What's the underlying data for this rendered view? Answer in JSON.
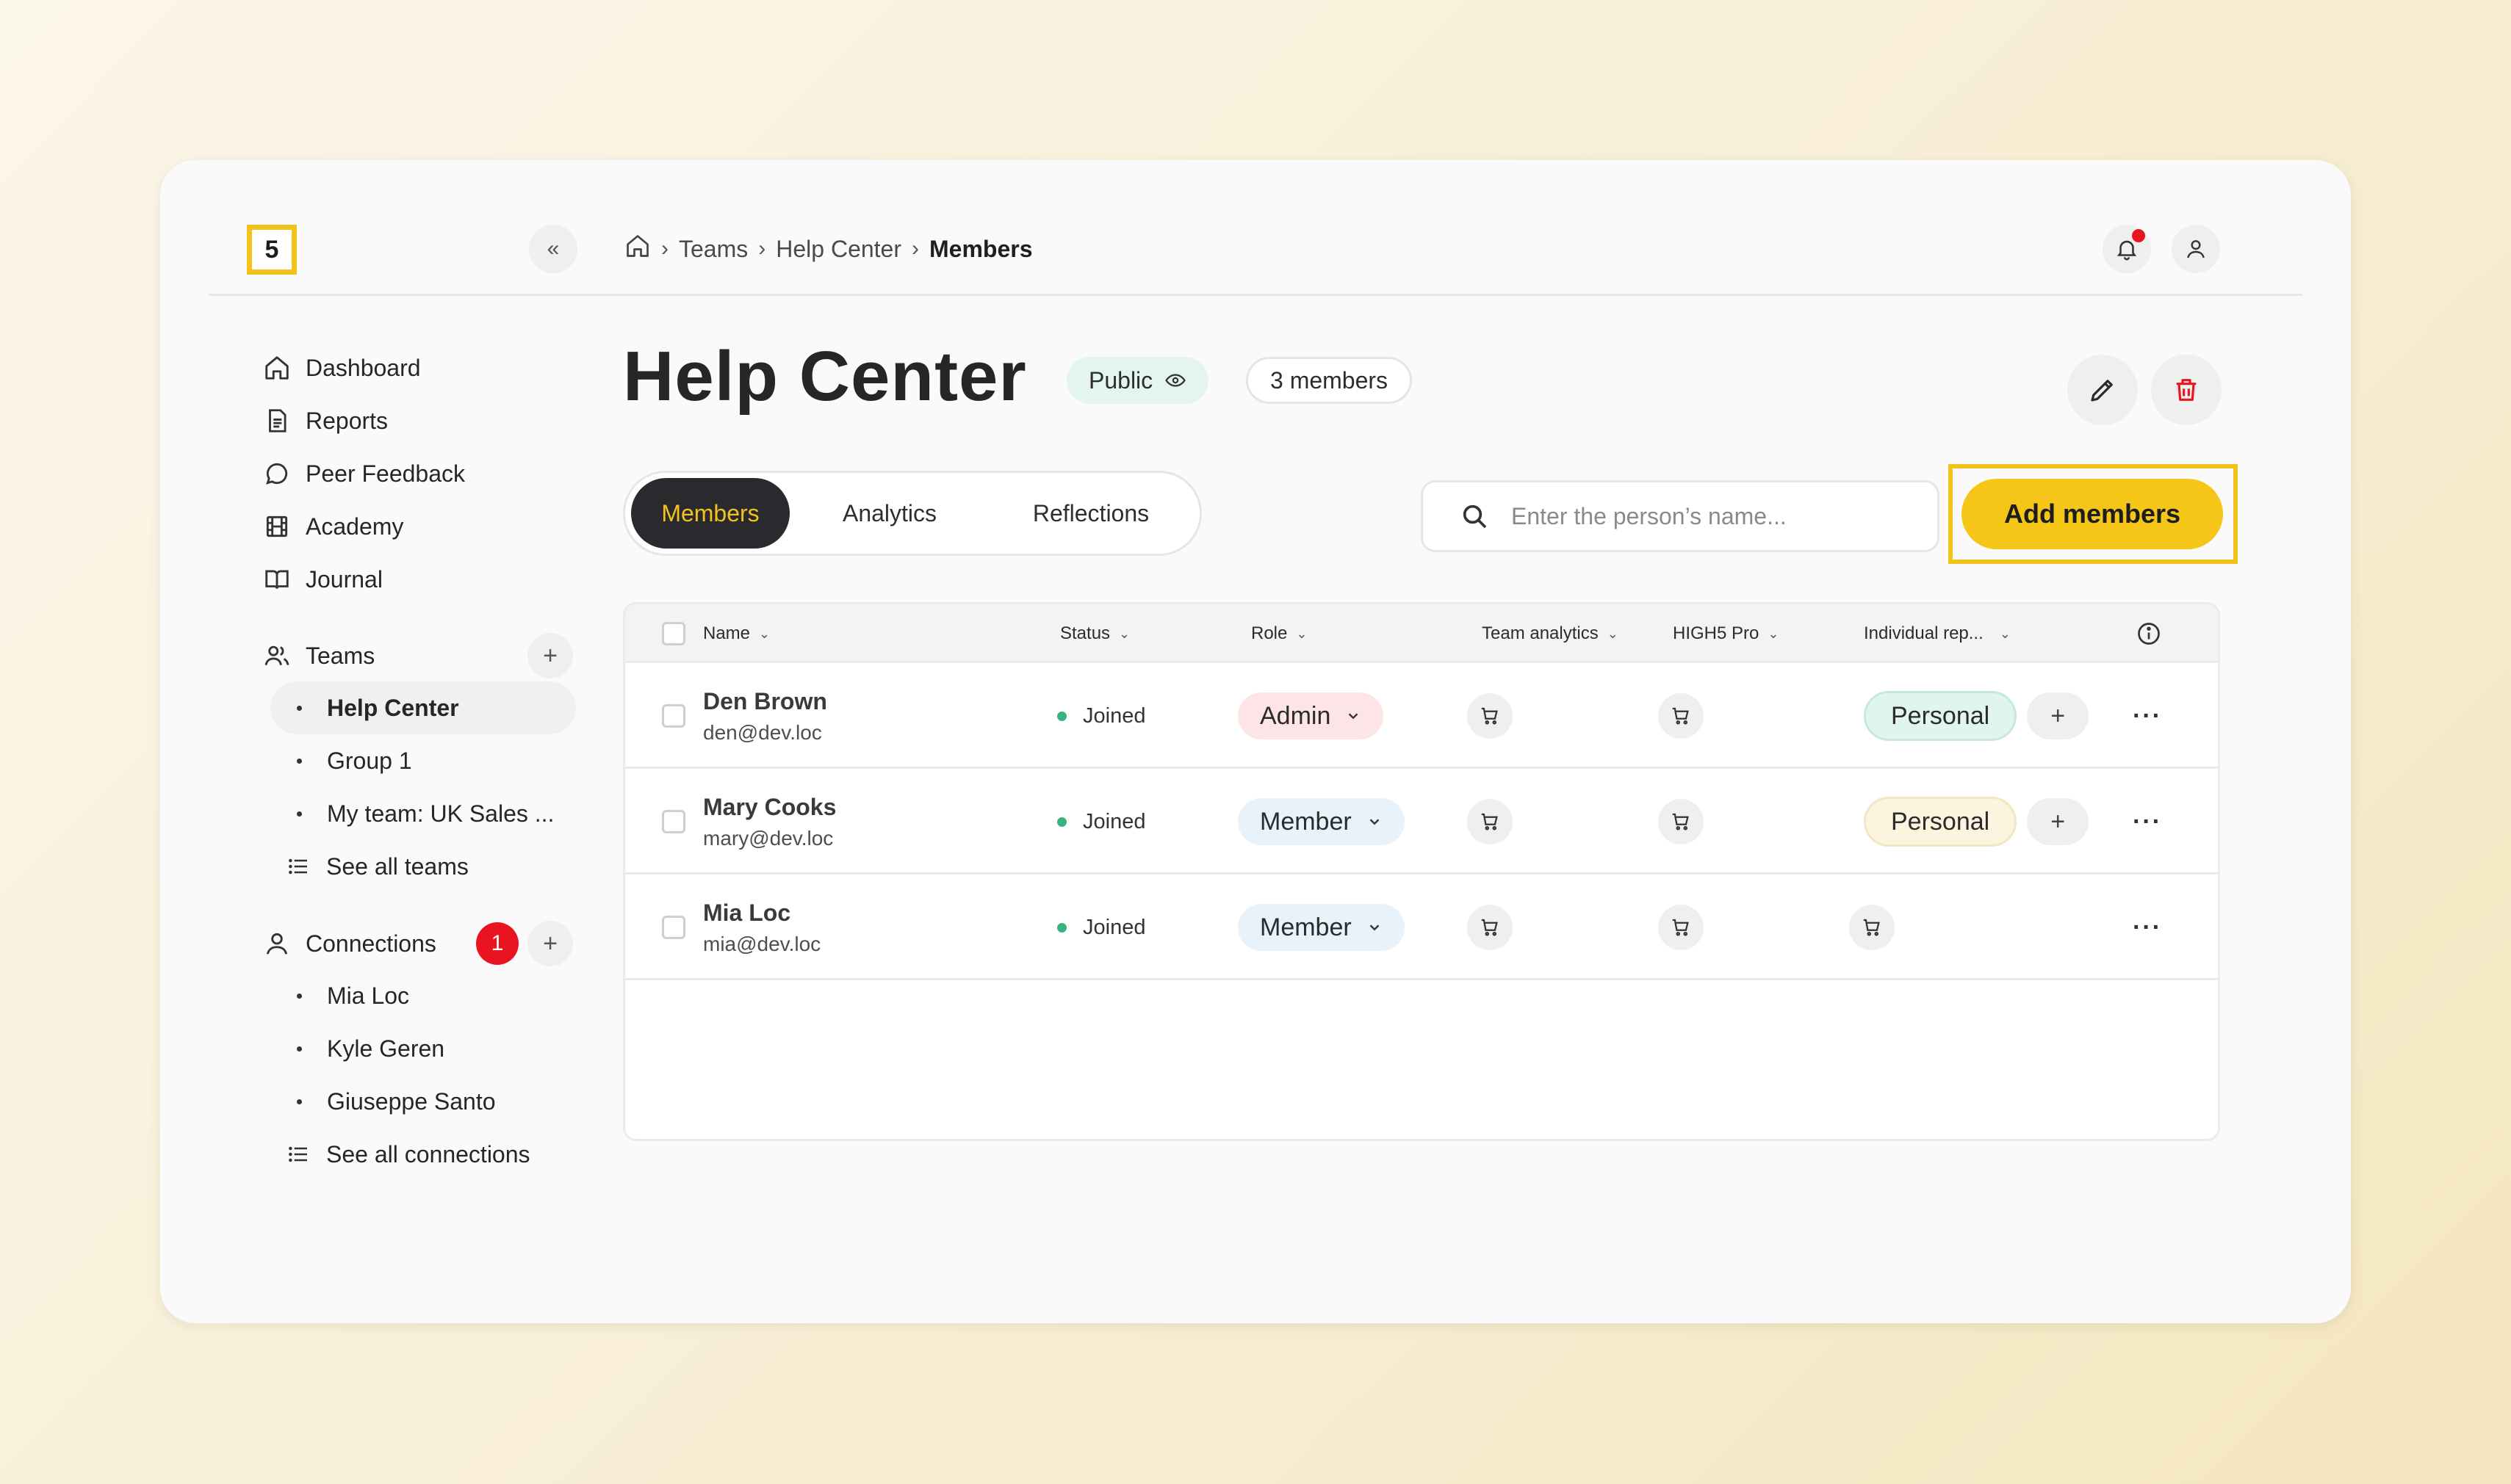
{
  "logo": {
    "text": "5"
  },
  "topbar": {
    "collapse_label": "«",
    "breadcrumb": [
      "Teams",
      "Help Center",
      "Members"
    ]
  },
  "sidebar": {
    "nav": [
      {
        "label": "Dashboard",
        "icon": "home-icon"
      },
      {
        "label": "Reports",
        "icon": "document-icon"
      },
      {
        "label": "Peer Feedback",
        "icon": "chat-icon"
      },
      {
        "label": "Academy",
        "icon": "film-icon"
      },
      {
        "label": "Journal",
        "icon": "book-icon"
      }
    ],
    "teams": {
      "label": "Teams",
      "items": [
        "Help Center",
        "Group 1",
        "My team: UK Sales ..."
      ],
      "see_all": "See all teams"
    },
    "connections": {
      "label": "Connections",
      "badge": "1",
      "items": [
        "Mia Loc",
        "Kyle Geren",
        "Giuseppe Santo"
      ],
      "see_all": "See all connections"
    }
  },
  "main": {
    "title": "Help Center",
    "visibility": "Public",
    "member_count": "3 members",
    "tabs": [
      "Members",
      "Analytics",
      "Reflections"
    ],
    "active_tab": "Members",
    "search_placeholder": "Enter the person’s name...",
    "add_button": "Add members"
  },
  "table": {
    "columns": [
      "Name",
      "Status",
      "Role",
      "Team analytics",
      "HIGH5 Pro",
      "Individual rep..."
    ],
    "rows": [
      {
        "name": "Den Brown",
        "email": "den@dev.loc",
        "status": "Joined",
        "role": "Admin",
        "report": "Personal",
        "report_color": "green"
      },
      {
        "name": "Mary Cooks",
        "email": "mary@dev.loc",
        "status": "Joined",
        "role": "Member",
        "report": "Personal",
        "report_color": "yellow"
      },
      {
        "name": "Mia Loc",
        "email": "mia@dev.loc",
        "status": "Joined",
        "role": "Member",
        "report": "",
        "report_color": ""
      }
    ]
  },
  "colors": {
    "accent": "#f5c518",
    "dark": "#2a2a2e",
    "alert": "#e8141f",
    "status_joined": "#36b37e"
  }
}
